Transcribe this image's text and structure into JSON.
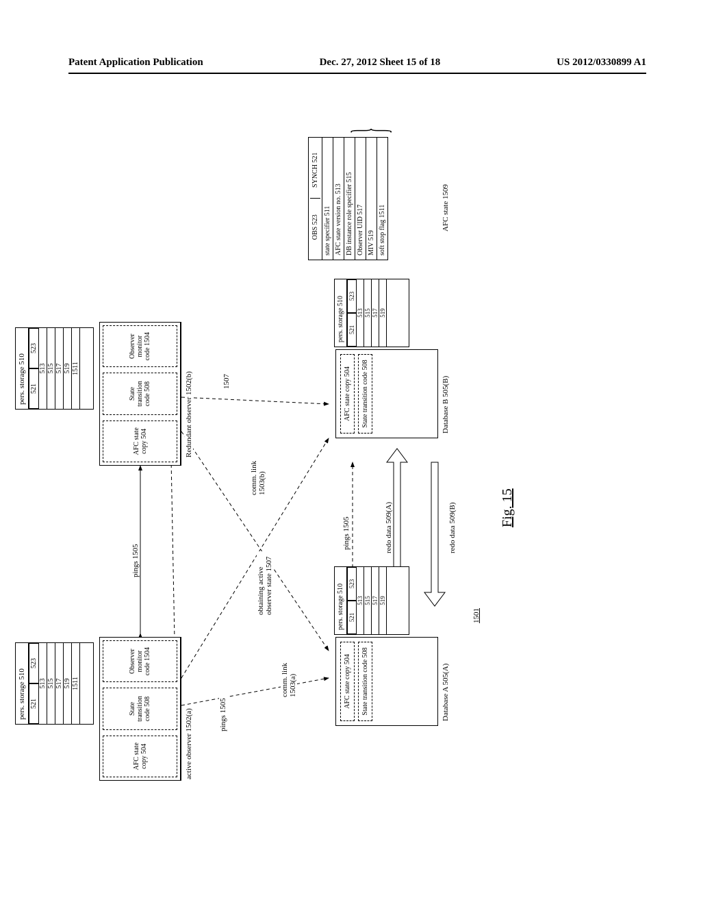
{
  "header": {
    "left": "Patent Application Publication",
    "center": "Dec. 27, 2012  Sheet 15 of 18",
    "right": "US 2012/0330899 A1"
  },
  "figure": {
    "label": "Fig. 15",
    "ref_1501": "1501"
  },
  "observer_a": {
    "caption": "active observer 1502(a)",
    "afc_state_copy": "AFC state copy 504",
    "state_transition": "State transition code 508",
    "observer_monitor": "Observer monitor code 1504"
  },
  "observer_b": {
    "caption": "Redundant observer 1502(b)",
    "afc_state_copy": "AFC state copy 504",
    "state_transition": "State transition code 508",
    "observer_monitor": "Observer monitor code 1504"
  },
  "pers_storage": {
    "title": "pers. storage 510",
    "c521": "521",
    "c523": "523",
    "c513": "513",
    "c515": "515",
    "c517": "517",
    "c519": "519",
    "c1511": "1511"
  },
  "db_a": {
    "caption": "Database A 505(A)",
    "afc_state_copy": "AFC state copy 504",
    "state_transition": "State transition code 508"
  },
  "db_b": {
    "caption": "Database B 505(B)",
    "afc_state_copy": "AFC state copy 504",
    "state_transition": "State transition code 508"
  },
  "labels": {
    "pings": "pings 1505",
    "pings2": "pings 1505",
    "pings3": "pings 1505",
    "comm_a": "comm. link 1503(a)",
    "comm_b": "comm. link 1503(b)",
    "redo_a": "redo data 509(A)",
    "redo_b": "redo data 509(B)",
    "obtaining": "obtaining active observer state 1507",
    "num1507": "1507"
  },
  "afc_state_table": {
    "title": "AFC state 1509",
    "obs": "OBS 523",
    "synch": "SYNCH 521",
    "state_specifier": "state specifier 511",
    "version": "AFC state version no. 513",
    "db_role": "DB instance role specifier 515",
    "observer_uid": "Observer UID 517",
    "miv": "MIV 519",
    "soft_stop": "soft stop flag 1511"
  }
}
